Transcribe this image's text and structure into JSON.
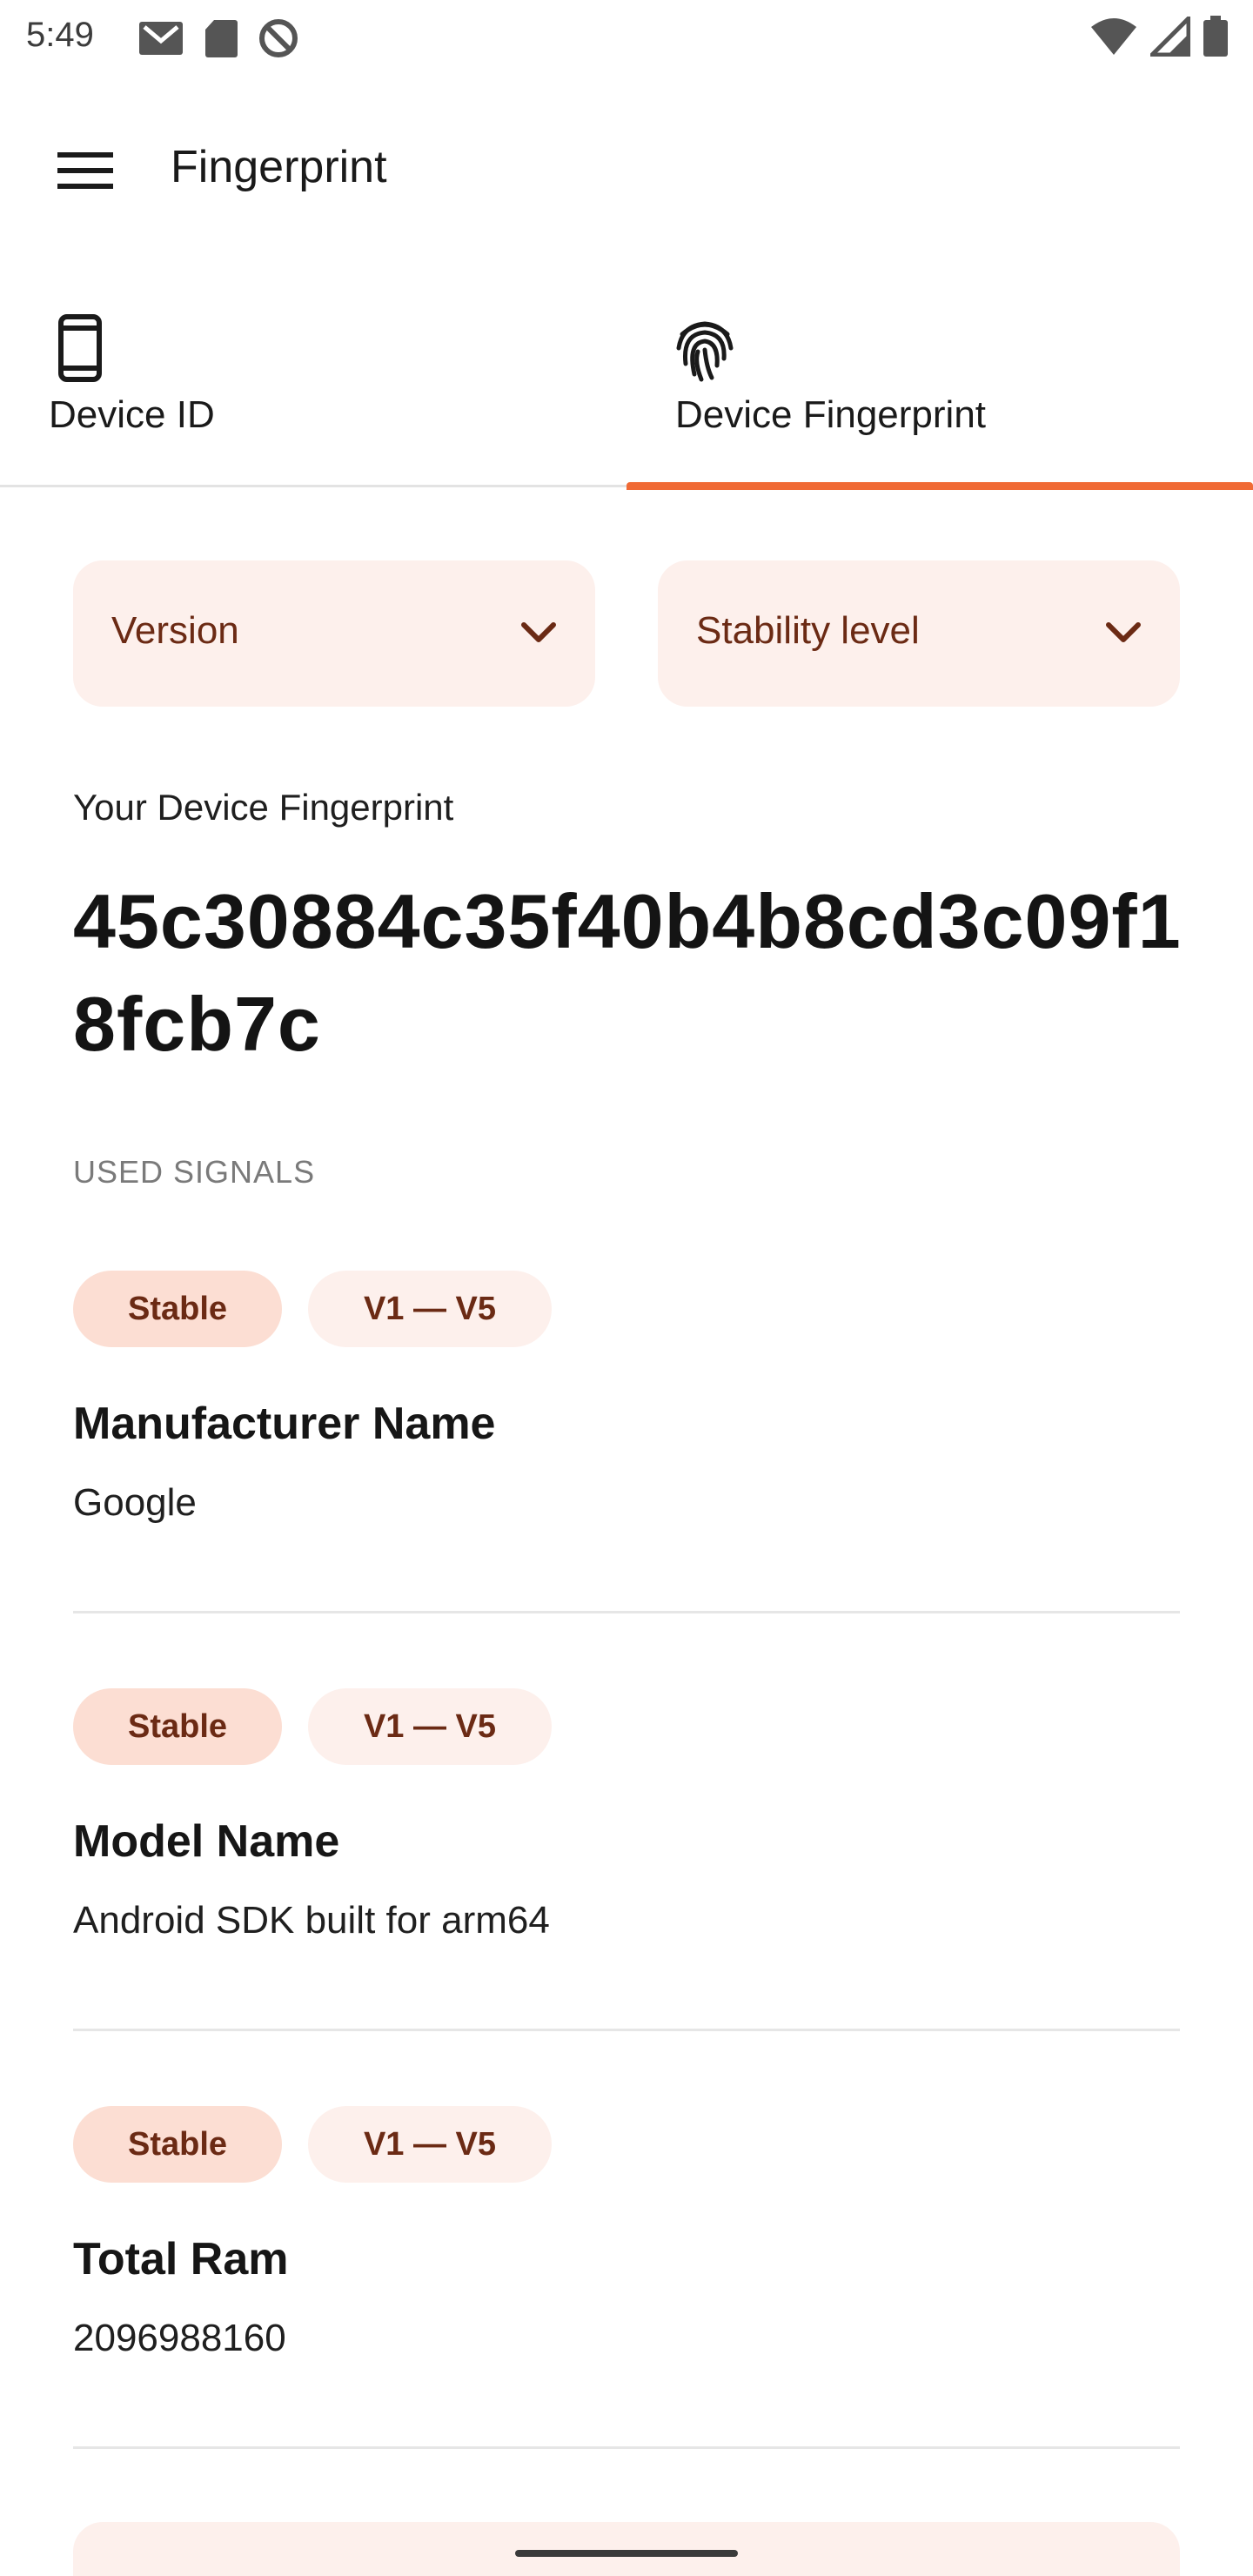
{
  "status_bar": {
    "time": "5:49",
    "left_icons": [
      "gmail-icon",
      "sd-card-icon",
      "data-saver-icon"
    ],
    "right_icons": [
      "wifi-icon",
      "signal-icon",
      "battery-icon"
    ]
  },
  "app_bar": {
    "title": "Fingerprint",
    "menu_icon": "hamburger-menu-icon"
  },
  "tabs": [
    {
      "label": "Device ID",
      "icon": "phone-icon",
      "selected": false
    },
    {
      "label": "Device Fingerprint",
      "icon": "fingerprint-icon",
      "selected": true
    }
  ],
  "filters": {
    "version": "Version",
    "stability": "Stability level"
  },
  "fingerprint": {
    "caption": "Your Device Fingerprint",
    "value": "45c30884c35f40b4b8cd3c09f18fcb7c"
  },
  "signals_label": "USED SIGNALS",
  "signals": [
    {
      "stability": "Stable",
      "versions": "V1 — V5",
      "name": "Manufacturer Name",
      "value": "Google"
    },
    {
      "stability": "Stable",
      "versions": "V1 — V5",
      "name": "Model Name",
      "value": "Android SDK built for arm64"
    },
    {
      "stability": "Stable",
      "versions": "V1 — V5",
      "name": "Total Ram",
      "value": "2096988160"
    }
  ],
  "colors": {
    "accent": "#f06a35",
    "chip_stable_bg": "#fcded3",
    "chip_text": "#6b2a14",
    "surface_tint": "#fdf0ec"
  }
}
